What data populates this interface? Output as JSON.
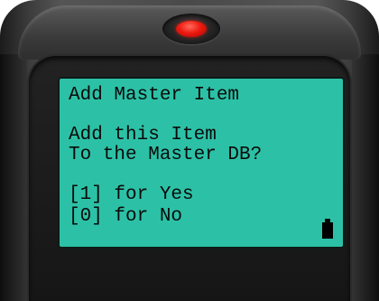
{
  "screen": {
    "title": "Add Master Item",
    "prompt_line1": "Add this Item",
    "prompt_line2": "To the Master DB?",
    "option_yes": "[1] for Yes",
    "option_no": "[0] for No"
  },
  "indicators": {
    "led_color": "#ee1a10",
    "battery_icon": "battery-icon"
  },
  "colors": {
    "screen_background": "#2cc1a6",
    "device_body": "#4a4a4a",
    "text": "#0a0a0a"
  }
}
